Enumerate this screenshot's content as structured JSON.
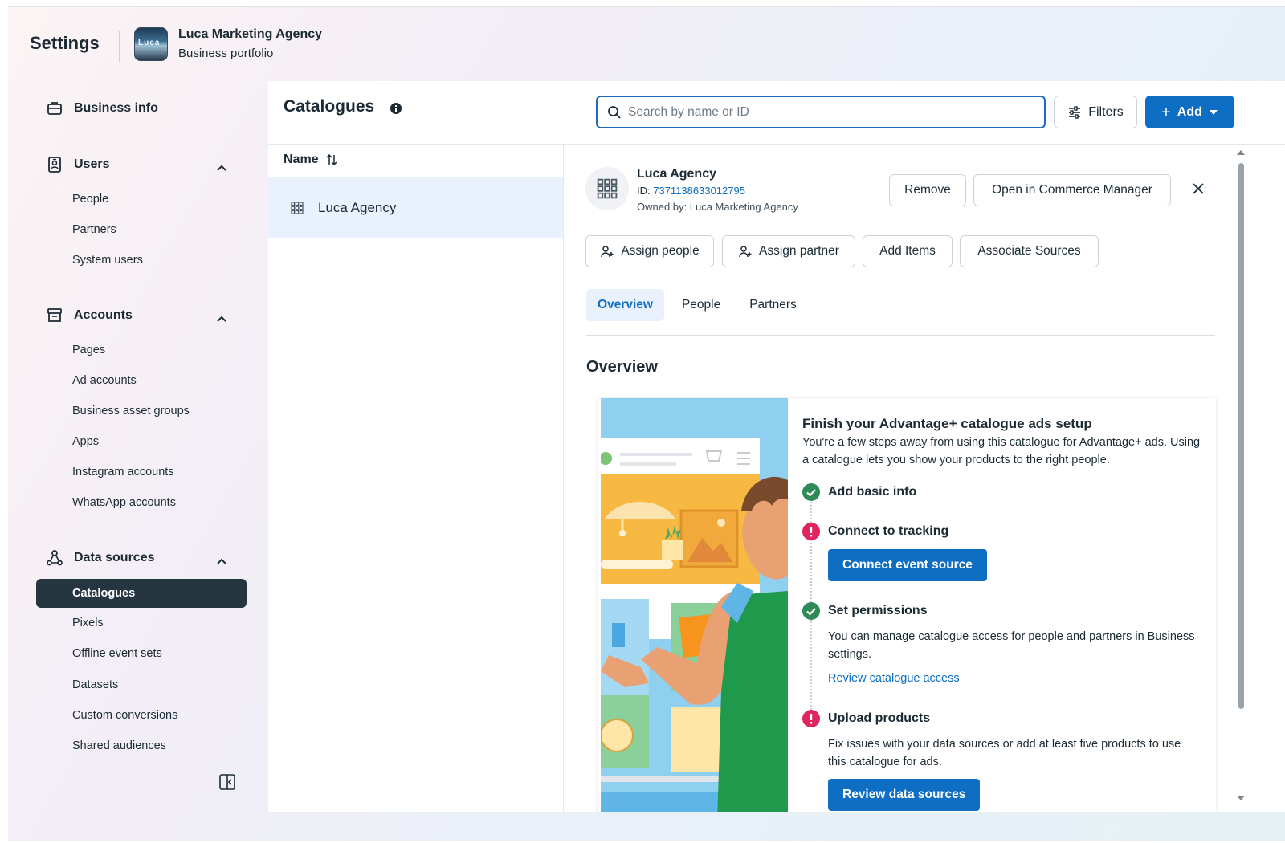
{
  "header": {
    "title": "Settings",
    "portfolio_logo_text": "Luca",
    "portfolio_name": "Luca Marketing Agency",
    "portfolio_type": "Business portfolio"
  },
  "sidebar": {
    "business_info": "Business info",
    "users": {
      "label": "Users",
      "items": [
        "People",
        "Partners",
        "System users"
      ]
    },
    "accounts": {
      "label": "Accounts",
      "items": [
        "Pages",
        "Ad accounts",
        "Business asset groups",
        "Apps",
        "Instagram accounts",
        "WhatsApp accounts"
      ]
    },
    "data_sources": {
      "label": "Data sources",
      "items": [
        "Catalogues",
        "Pixels",
        "Offline event sets",
        "Datasets",
        "Custom conversions",
        "Shared audiences"
      ]
    }
  },
  "main": {
    "title": "Catalogues",
    "search_placeholder": "Search by name or ID",
    "filters_label": "Filters",
    "add_label": "Add",
    "list_header": "Name",
    "list_items": [
      "Luca Agency"
    ]
  },
  "detail": {
    "name": "Luca Agency",
    "id_prefix": "ID: ",
    "id_value": "7371138633012795",
    "owner": "Owned by: Luca Marketing Agency",
    "remove_label": "Remove",
    "open_commerce_label": "Open in Commerce Manager",
    "assign_people_label": "Assign people",
    "assign_partner_label": "Assign partner",
    "add_items_label": "Add Items",
    "associate_sources_label": "Associate Sources",
    "tabs": [
      "Overview",
      "People",
      "Partners"
    ],
    "section_title": "Overview",
    "card": {
      "title": "Finish your Advantage+ catalogue ads setup",
      "description": "You're a few steps away from using this catalogue for Advantage+ ads. Using a catalogue lets you show your products to the right people.",
      "steps": [
        {
          "label": "Add basic info",
          "status": "complete"
        },
        {
          "label": "Connect to tracking",
          "status": "error",
          "button": "Connect event source"
        },
        {
          "label": "Set permissions",
          "status": "complete",
          "text": "You can manage catalogue access for people and partners in Business settings.",
          "link": "Review catalogue access"
        },
        {
          "label": "Upload products",
          "status": "error",
          "text": "Fix issues with your data sources or add at least five products to use this catalogue for ads.",
          "button": "Review data sources"
        }
      ]
    }
  },
  "colors": {
    "primary": "#0d6ec4",
    "success": "#2e8b57",
    "error": "#e0245e",
    "active_nav": "#263641"
  }
}
